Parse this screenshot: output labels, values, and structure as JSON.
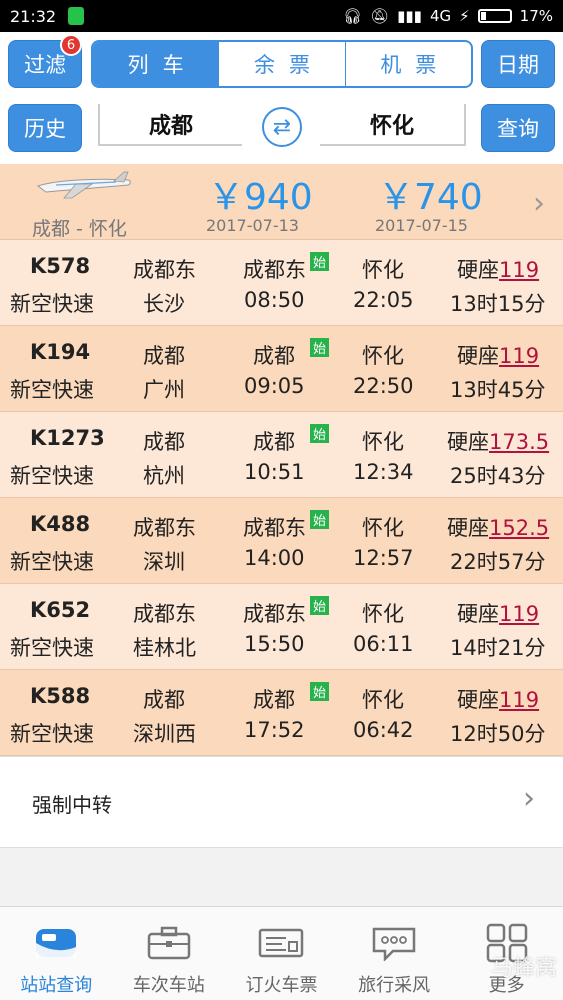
{
  "status": {
    "time": "21:32",
    "network": "4G",
    "battery": "17%"
  },
  "header": {
    "filter_label": "过滤",
    "filter_badge": "6",
    "segments": [
      {
        "label": "列车",
        "active": true
      },
      {
        "label": "余票",
        "active": false
      },
      {
        "label": "机票",
        "active": false
      }
    ],
    "date_label": "日期",
    "history_label": "历史",
    "from_station": "成都",
    "to_station": "怀化",
    "query_label": "查询"
  },
  "flight": {
    "route": "成都 - 怀化",
    "prices": [
      {
        "price": "￥940",
        "date": "2017-07-13"
      },
      {
        "price": "￥740",
        "date": "2017-07-15"
      }
    ]
  },
  "trains": [
    {
      "no": "K578",
      "type": "新空快速",
      "from_city": "成都东",
      "to_city": "长沙",
      "depart_station": "成都东",
      "start_mark": "始",
      "depart_time": "08:50",
      "arrive_station": "怀化",
      "arrive_time": "22:05",
      "seat": "硬座",
      "price": "119",
      "duration": "13时15分"
    },
    {
      "no": "K194",
      "type": "新空快速",
      "from_city": "成都",
      "to_city": "广州",
      "depart_station": "成都",
      "start_mark": "始",
      "depart_time": "09:05",
      "arrive_station": "怀化",
      "arrive_time": "22:50",
      "seat": "硬座",
      "price": "119",
      "duration": "13时45分"
    },
    {
      "no": "K1273",
      "type": "新空快速",
      "from_city": "成都",
      "to_city": "杭州",
      "depart_station": "成都",
      "start_mark": "始",
      "depart_time": "10:51",
      "arrive_station": "怀化",
      "arrive_time": "12:34",
      "seat": "硬座",
      "price": "173.5",
      "duration": "25时43分"
    },
    {
      "no": "K488",
      "type": "新空快速",
      "from_city": "成都东",
      "to_city": "深圳",
      "depart_station": "成都东",
      "start_mark": "始",
      "depart_time": "14:00",
      "arrive_station": "怀化",
      "arrive_time": "12:57",
      "seat": "硬座",
      "price": "152.5",
      "duration": "22时57分"
    },
    {
      "no": "K652",
      "type": "新空快速",
      "from_city": "成都东",
      "to_city": "桂林北",
      "depart_station": "成都东",
      "start_mark": "始",
      "depart_time": "15:50",
      "arrive_station": "怀化",
      "arrive_time": "06:11",
      "seat": "硬座",
      "price": "119",
      "duration": "14时21分"
    },
    {
      "no": "K588",
      "type": "新空快速",
      "from_city": "成都",
      "to_city": "深圳西",
      "depart_station": "成都",
      "start_mark": "始",
      "depart_time": "17:52",
      "arrive_station": "怀化",
      "arrive_time": "06:42",
      "seat": "硬座",
      "price": "119",
      "duration": "12时50分"
    }
  ],
  "transfer_label": "强制中转",
  "tabs": [
    {
      "label": "站站查询",
      "icon": "train-icon",
      "active": true
    },
    {
      "label": "车次车站",
      "icon": "briefcase-icon",
      "active": false
    },
    {
      "label": "订火车票",
      "icon": "ticket-icon",
      "active": false
    },
    {
      "label": "旅行采风",
      "icon": "chat-icon",
      "active": false
    },
    {
      "label": "更多",
      "icon": "grid-icon",
      "active": false
    }
  ],
  "watermark": "马蜂窝",
  "colors": {
    "accent": "#3e8fe0",
    "price_blue": "#2a94e8",
    "price_red": "#b0123d",
    "start_green": "#28b24b",
    "row_light": "#fde8d7",
    "row_dark": "#fbd9bc"
  }
}
